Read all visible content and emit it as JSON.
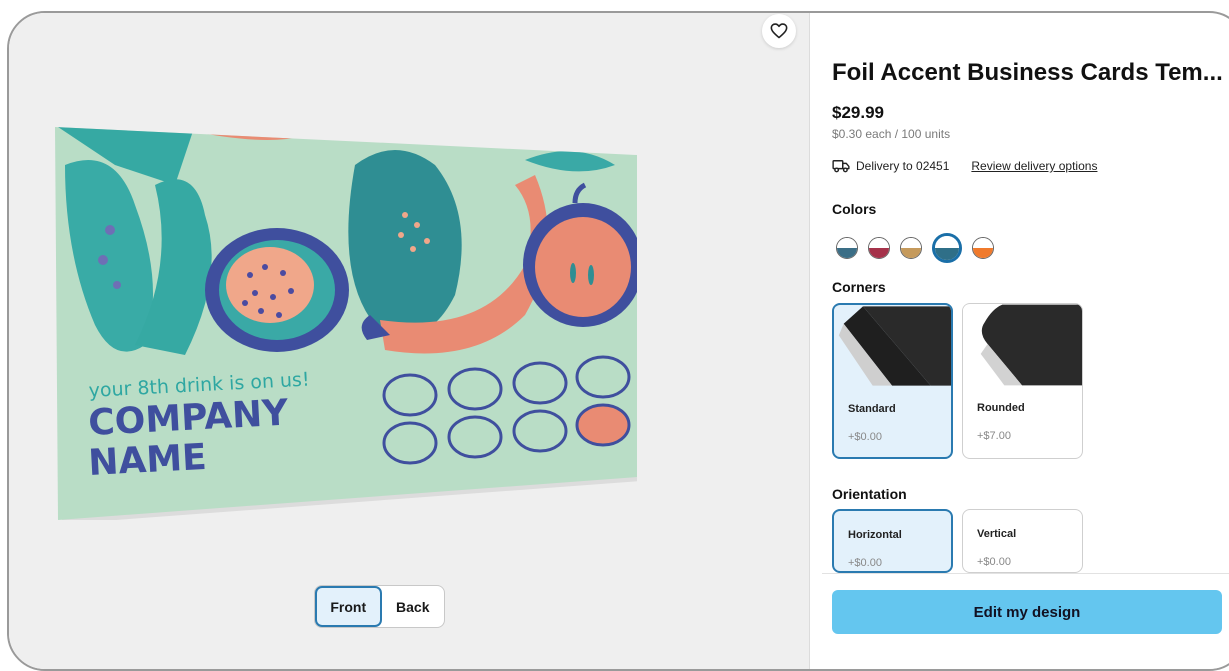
{
  "product": {
    "title": "Foil Accent Business Cards Tem...",
    "price": "$29.99",
    "unit_price": "$0.30 each / 100 units"
  },
  "delivery": {
    "text": "Delivery to 02451",
    "link": "Review delivery options",
    "icon": "truck-icon"
  },
  "card": {
    "tagline": "your 8th drink is on us!",
    "company_line1": "COMPANY",
    "company_line2": "NAME"
  },
  "view_toggle": {
    "front": "Front",
    "back": "Back",
    "selected": "Front"
  },
  "colors": {
    "label": "Colors",
    "swatches": [
      {
        "top": "#ffffff",
        "bottom": "#3b6e86"
      },
      {
        "top": "#ffffff",
        "bottom": "#a5324a"
      },
      {
        "top": "#ffffff",
        "bottom": "#c59a5c"
      },
      {
        "top": "#ffffff",
        "bottom": "#2f6f88",
        "selected": true
      },
      {
        "top": "#ffffff",
        "bottom": "#f07a2c"
      }
    ]
  },
  "corners": {
    "label": "Corners",
    "options": [
      {
        "name": "Standard",
        "cost": "+$0.00",
        "selected": true
      },
      {
        "name": "Rounded",
        "cost": "+$7.00",
        "selected": false
      }
    ]
  },
  "orientation": {
    "label": "Orientation",
    "options": [
      {
        "name": "Horizontal",
        "cost": "+$0.00",
        "selected": true
      },
      {
        "name": "Vertical",
        "cost": "+$0.00",
        "selected": false
      }
    ]
  },
  "cta": {
    "label": "Edit my design"
  },
  "icons": {
    "favorite": "heart-icon"
  }
}
